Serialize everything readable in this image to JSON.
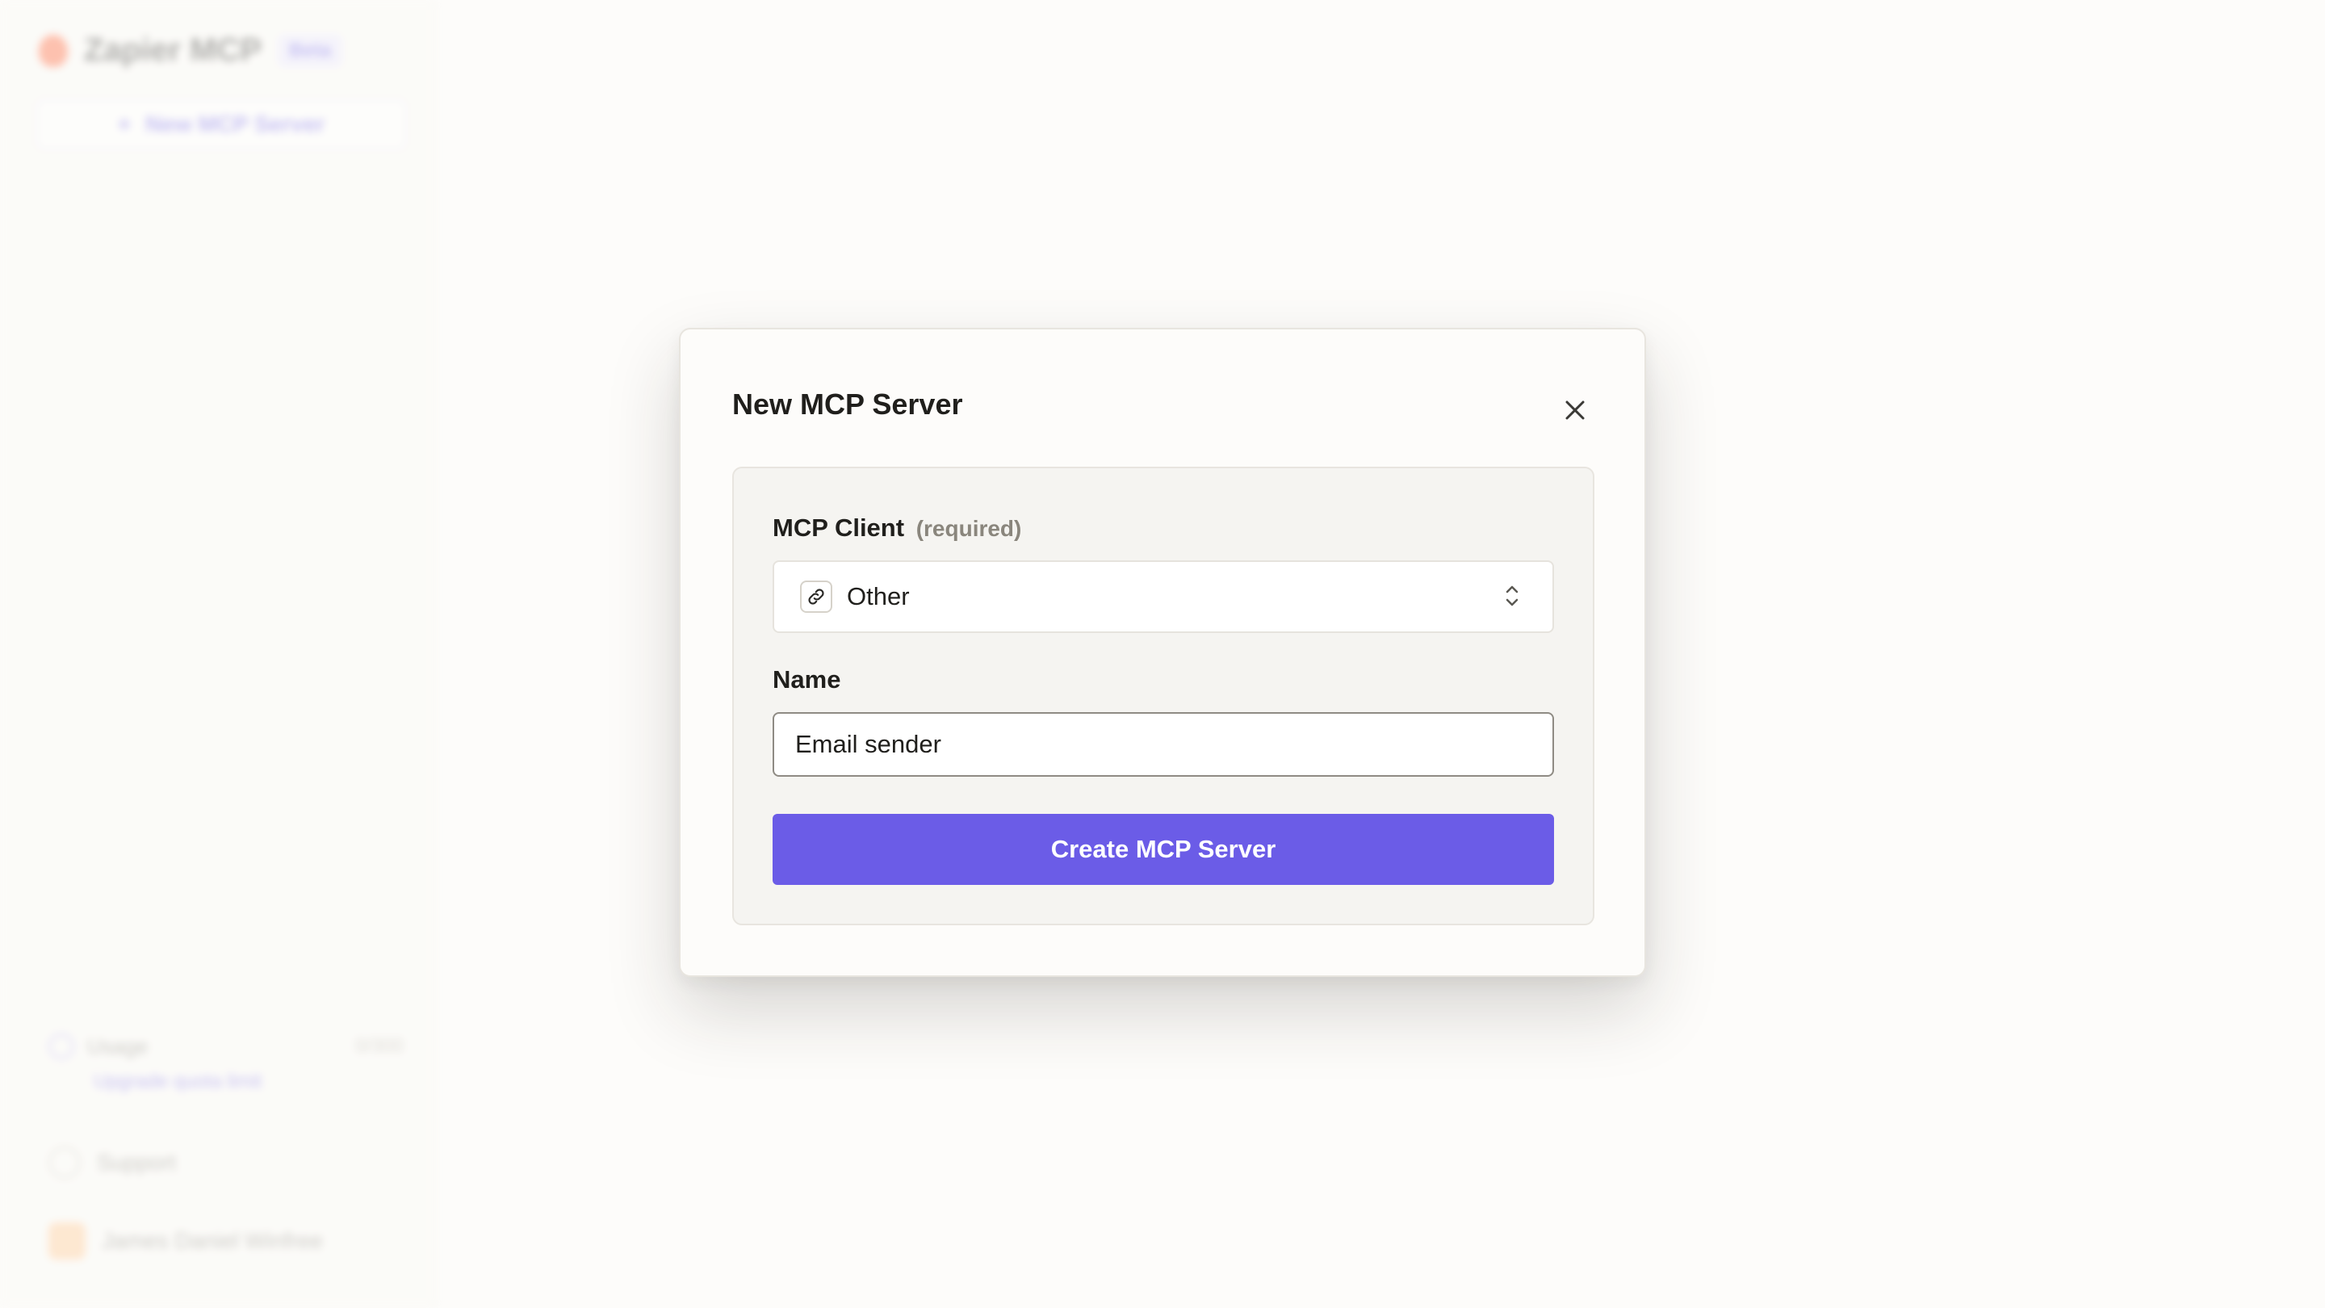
{
  "background": {
    "brand": {
      "name": "Zapier MCP",
      "badge": "Beta"
    },
    "sidebar": {
      "new_server_label": "New MCP Server",
      "usage": {
        "label": "Usage",
        "count": "0/300",
        "link": "Upgrade quota limit"
      },
      "support_label": "Support",
      "account_name": "James Daniel Winfree"
    }
  },
  "modal": {
    "title": "New MCP Server",
    "close_icon": "close-icon",
    "client_field": {
      "label": "MCP Client",
      "required_hint": "(required)",
      "selected_value": "Other",
      "icon": "link-icon"
    },
    "name_field": {
      "label": "Name",
      "value": "Email sender"
    },
    "submit_label": "Create MCP Server"
  },
  "colors": {
    "accent": "#6b5ce7",
    "background": "#fdfcfa",
    "card": "#f5f4f1",
    "text": "#201f1c"
  }
}
